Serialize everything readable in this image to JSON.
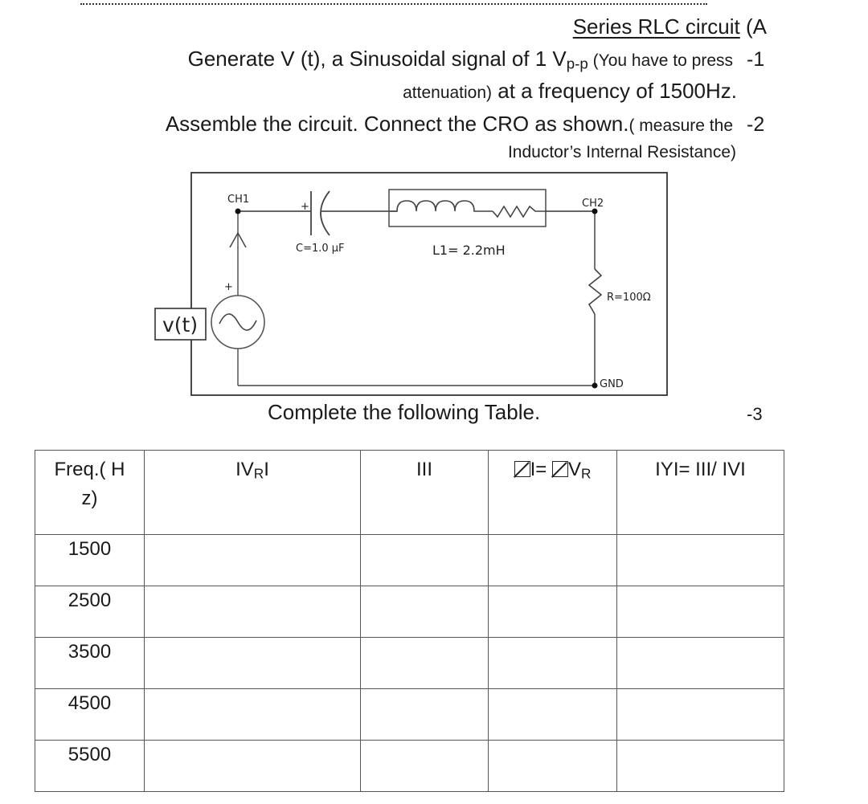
{
  "document": {
    "heading": {
      "title": "Series RLC circuit",
      "suffix": " (A"
    },
    "steps": [
      {
        "number": "-1",
        "line1_main": "Generate V (t), a Sinusoidal signal of 1 V",
        "line1_sub": "p-p",
        "line1_small": " (You have to press",
        "line2_small": "attenuation)",
        "line2_main": " at a frequency of 1500Hz."
      },
      {
        "number": "-2",
        "line1_main": "Assemble the circuit. Connect the CRO as shown.",
        "line1_small": "( measure the",
        "line2_small": "Inductor’s Internal Resistance)"
      },
      {
        "number": "-3",
        "text": "Complete the following Table."
      }
    ]
  },
  "circuit": {
    "source_label": "v(t)",
    "source_plus": "+",
    "ch1_label": "CH1",
    "ch2_label": "CH2",
    "gnd_label": "GND",
    "capacitor_plus": "+",
    "capacitor_label": "C=1.0 µF",
    "inductor_label": "L1= 2.2mH",
    "resistor_label": "R=100Ω"
  },
  "table": {
    "headers": {
      "freq": "Freq.( H z)",
      "freq_line1": "Freq.( H",
      "freq_line2": "z)",
      "vr_prefix": "IV",
      "vr_sub": "R",
      "vr_suffix": "I",
      "current": "III",
      "phase_mid": "I= ",
      "phase_sub": "R",
      "phase_v": "V",
      "admittance": "IYI= III/ IVI"
    },
    "rows": [
      {
        "freq": "1500",
        "vr": "",
        "i": "",
        "phase": "",
        "y": ""
      },
      {
        "freq": "2500",
        "vr": "",
        "i": "",
        "phase": "",
        "y": ""
      },
      {
        "freq": "3500",
        "vr": "",
        "i": "",
        "phase": "",
        "y": ""
      },
      {
        "freq": "4500",
        "vr": "",
        "i": "",
        "phase": "",
        "y": ""
      },
      {
        "freq": "5500",
        "vr": "",
        "i": "",
        "phase": "",
        "y": ""
      }
    ]
  }
}
